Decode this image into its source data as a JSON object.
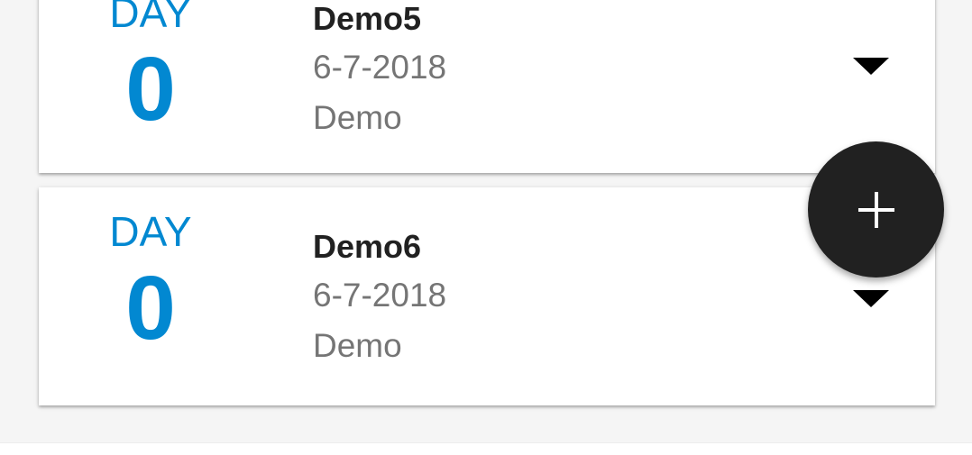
{
  "theme": {
    "accent": "#0288d1",
    "fab_background": "#212121",
    "card_background": "#ffffff",
    "page_background": "#f5f5f5"
  },
  "events": [
    {
      "day_label": "DAY",
      "day_count": "0",
      "title": "Demo5",
      "date": "6-7-2018",
      "description": "Demo",
      "expand_icon": "arrow-drop-down-icon"
    },
    {
      "day_label": "DAY",
      "day_count": "0",
      "title": "Demo6",
      "date": "6-7-2018",
      "description": "Demo",
      "expand_icon": "arrow-drop-down-icon"
    }
  ],
  "fab": {
    "icon": "plus-icon",
    "label": "+"
  }
}
